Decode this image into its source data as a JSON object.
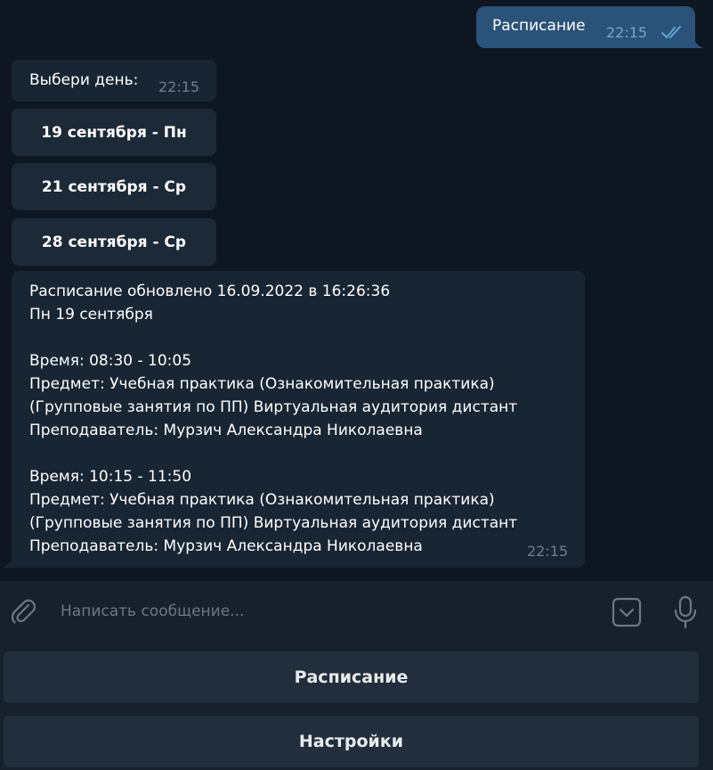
{
  "messages": {
    "outgoing": {
      "text": "Расписание",
      "time": "22:15"
    },
    "prompt": {
      "text": "Выбери день:",
      "time": "22:15"
    },
    "inline_buttons": [
      {
        "label": "19 сентября - Пн"
      },
      {
        "label": "21 сентября - Ср"
      },
      {
        "label": "28 сентября - Ср"
      }
    ],
    "schedule": {
      "text": "Расписание обновлено 16.09.2022 в 16:26:36\nПн 19 сентября\n\nВремя: 08:30 - 10:05\nПредмет: Учебная практика (Ознакомительная практика)\n(Групповые занятия по ПП) Виртуальная аудитория дистант\nПреподаватель: Мурзич Александра Николаевна\n\nВремя: 10:15 - 11:50\nПредмет: Учебная практика (Ознакомительная практика)\n(Групповые занятия по ПП) Виртуальная аудитория дистант\nПреподаватель: Мурзич Александра Николаевна",
      "time": "22:15"
    }
  },
  "composer": {
    "placeholder": "Написать сообщение...",
    "icons": {
      "attach": "paperclip-icon",
      "keyboard": "keyboard-toggle-icon",
      "mic": "microphone-icon"
    }
  },
  "reply_keyboard": [
    {
      "label": "Расписание"
    },
    {
      "label": "Настройки"
    }
  ],
  "colors": {
    "background": "#0e1621",
    "outgoing_bubble": "#2b5278",
    "incoming_bubble": "#182533",
    "panel": "#17212b",
    "keyboard_button": "#232e3c"
  }
}
